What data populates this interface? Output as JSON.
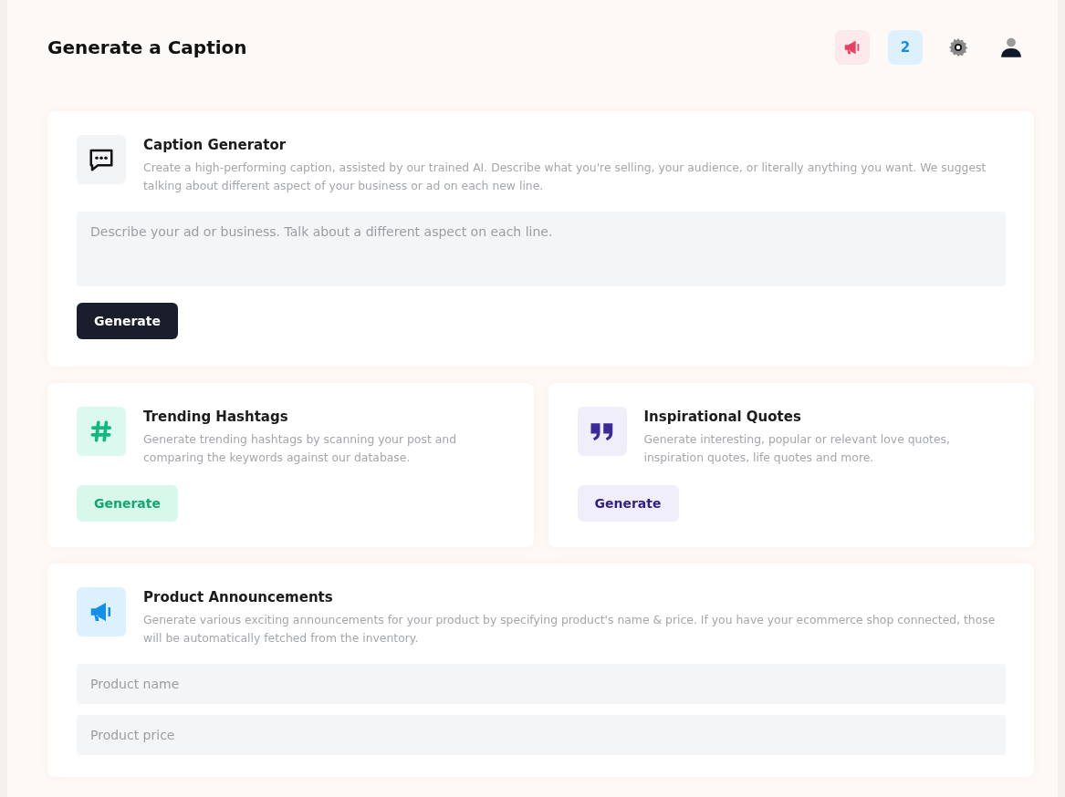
{
  "header": {
    "title": "Generate a Caption",
    "notification_count": "2"
  },
  "cards": [
    {
      "kind": "prompt",
      "title": "Caption Generator",
      "description": "Create a high-performing caption, assisted by our trained AI. Describe what you're selling, your audience, or literally anything you want. We suggest talking about different aspect of your business or ad on each new line.",
      "placeholder": "Describe your ad or business. Talk about a different aspect on each line.",
      "button": "Generate"
    },
    {
      "kind": "action",
      "title": "Trending Hashtags",
      "description": "Generate trending hashtags by scanning your post and comparing the keywords against our database.",
      "button": "Generate"
    },
    {
      "kind": "action",
      "title": "Inspirational Quotes",
      "description": "Generate interesting, popular or relevant love quotes, inspiration quotes, life quotes and more.",
      "button": "Generate"
    },
    {
      "kind": "fields",
      "title": "Product Announcements",
      "description": "Generate various exciting announcements for your product by specifying product's name & price. If you have your ecommerce shop connected, those will be automatically fetched from the inventory.",
      "fields": [
        {
          "placeholder": "Product name"
        },
        {
          "placeholder": "Product price"
        }
      ]
    }
  ]
}
